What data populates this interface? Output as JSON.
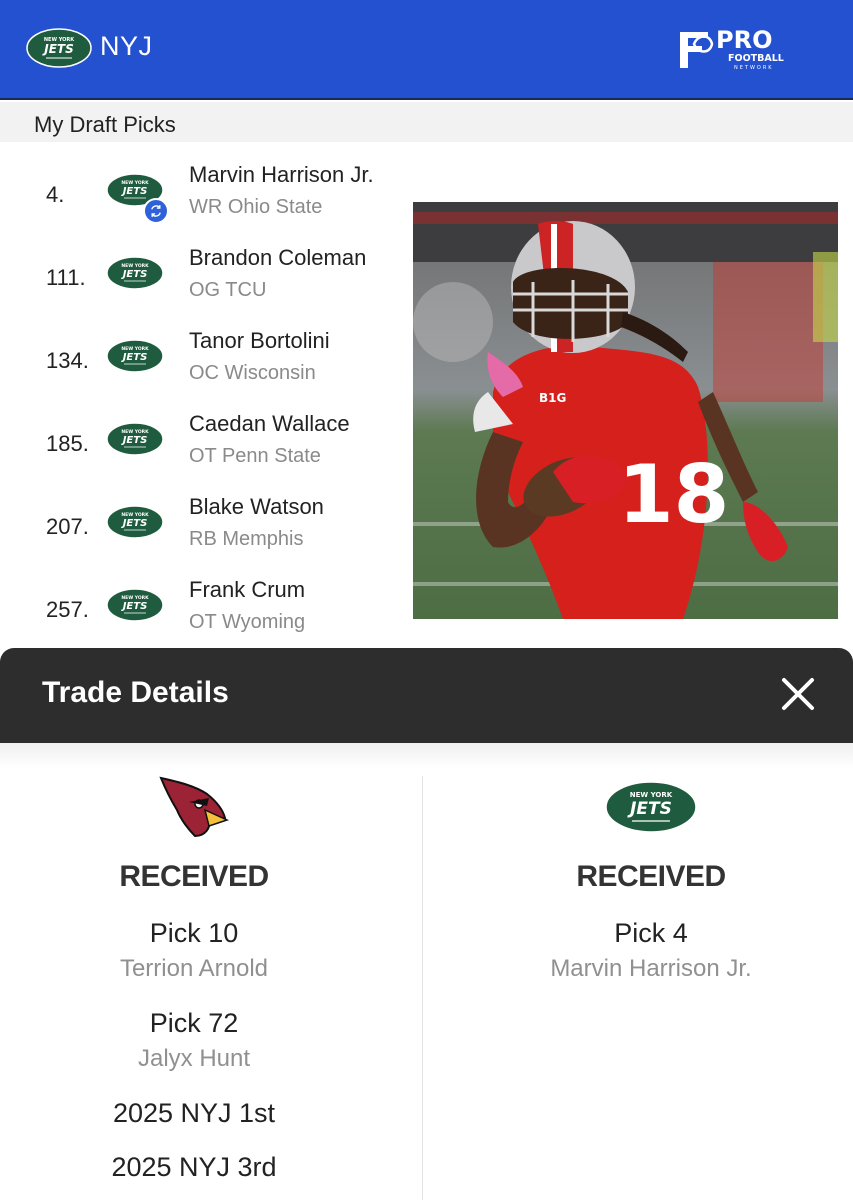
{
  "header": {
    "team_abbr": "NYJ",
    "logo_text_top": "NEW YORK",
    "logo_text_main": "JETS",
    "brand_logo_line1": "PRO",
    "brand_logo_line2": "FOOTBALL",
    "brand_logo_line3": "NETWORK",
    "colors": {
      "bar": "#2451cf",
      "jets_green": "#1f5c3f"
    }
  },
  "section_title": "My Draft Picks",
  "picks": [
    {
      "number": "4.",
      "name": "Marvin Harrison Jr.",
      "details": "WR Ohio State",
      "icon": "jets-logo-icon",
      "traded_icon": "swap-icon"
    },
    {
      "number": "111.",
      "name": "Brandon Coleman",
      "details": "OG TCU",
      "icon": "jets-logo-icon"
    },
    {
      "number": "134.",
      "name": "Tanor Bortolini",
      "details": "OC Wisconsin",
      "icon": "jets-logo-icon"
    },
    {
      "number": "185.",
      "name": "Caedan Wallace",
      "details": "OT Penn State",
      "icon": "jets-logo-icon"
    },
    {
      "number": "207.",
      "name": "Blake Watson",
      "details": "RB Memphis",
      "icon": "jets-logo-icon"
    },
    {
      "number": "257.",
      "name": "Frank Crum",
      "details": "OT Wyoming",
      "icon": "jets-logo-icon"
    }
  ],
  "photo": {
    "jersey_number": "18",
    "conference_mark": "B1G",
    "description_icon": "player-photo"
  },
  "trade": {
    "title": "Trade Details",
    "close_icon": "close-icon",
    "left": {
      "team_icon": "cardinals-logo-icon",
      "heading": "RECEIVED",
      "items": [
        {
          "pick": "Pick 10",
          "player": "Terrion Arnold"
        },
        {
          "pick": "Pick 72",
          "player": "Jalyx Hunt"
        }
      ],
      "future": [
        "2025 NYJ 1st",
        "2025 NYJ 3rd"
      ]
    },
    "right": {
      "team_icon": "jets-logo-icon",
      "heading": "RECEIVED",
      "items": [
        {
          "pick": "Pick 4",
          "player": "Marvin Harrison Jr."
        }
      ]
    }
  }
}
